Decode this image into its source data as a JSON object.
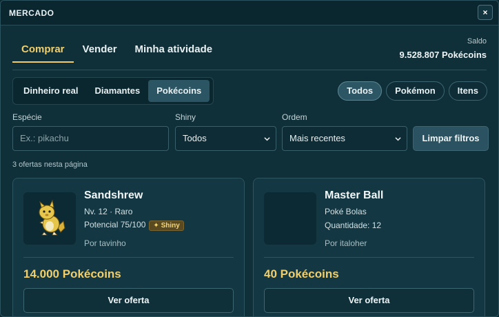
{
  "window": {
    "title": "MERCADO",
    "close_label": "×"
  },
  "tabs": [
    {
      "label": "Comprar",
      "active": true
    },
    {
      "label": "Vender",
      "active": false
    },
    {
      "label": "Minha atividade",
      "active": false
    }
  ],
  "balance": {
    "label": "Saldo",
    "value": "9.528.807 Pokécoins"
  },
  "currency_filter": [
    {
      "label": "Dinheiro real",
      "active": false
    },
    {
      "label": "Diamantes",
      "active": false
    },
    {
      "label": "Pokécoins",
      "active": true
    }
  ],
  "type_filter": [
    {
      "label": "Todos",
      "active": true
    },
    {
      "label": "Pokémon",
      "active": false
    },
    {
      "label": "Itens",
      "active": false
    }
  ],
  "filters": {
    "species": {
      "label": "Espécie",
      "placeholder": "Ex.: pikachu"
    },
    "shiny": {
      "label": "Shiny",
      "value": "Todos"
    },
    "order": {
      "label": "Ordem",
      "value": "Mais recentes"
    },
    "clear_label": "Limpar filtros"
  },
  "offer_count": "3 ofertas nesta página",
  "offers": [
    {
      "name": "Sandshrew",
      "line1": "Nv. 12 · Raro",
      "line2": "Potencial 75/100",
      "badge": "✦ Shiny",
      "seller": "Por tavinho",
      "price": "14.000 Pokécoins",
      "button": "Ver oferta",
      "icon": "sandshrew-sprite-icon"
    },
    {
      "name": "Master Ball",
      "line1": "Poké Bolas",
      "line2": "Quantidade: 12",
      "seller": "Por italoher",
      "price": "40 Pokécoins",
      "button": "Ver oferta"
    }
  ],
  "colors": {
    "accent": "#f2cf6a",
    "background": "#0f3039",
    "card": "#133843",
    "active_button": "#2c5563"
  }
}
